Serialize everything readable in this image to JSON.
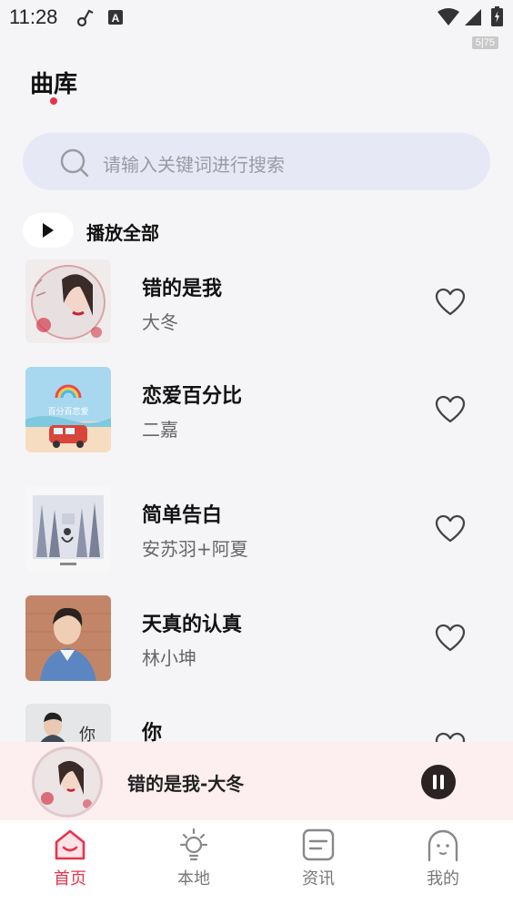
{
  "status_bar": {
    "time": "11:28",
    "fps": "5|75",
    "icons": [
      "link-icon",
      "a-icon",
      "wifi-icon",
      "signal-icon",
      "battery-icon"
    ]
  },
  "header": {
    "title": "曲库"
  },
  "search": {
    "placeholder": "请输入关键词进行搜索"
  },
  "play_all": {
    "label": "播放全部"
  },
  "songs": [
    {
      "title": "错的是我",
      "artist": "大冬",
      "liked": false
    },
    {
      "title": "恋爱百分比",
      "artist": "二嘉",
      "liked": false
    },
    {
      "title": "简单告白",
      "artist": "安苏羽+阿夏",
      "liked": false
    },
    {
      "title": "天真的认真",
      "artist": "林小坤",
      "liked": false
    },
    {
      "title": "你",
      "artist": "",
      "liked": false
    }
  ],
  "covers": {
    "song2_text": "百分百恋爱",
    "song5_text": "你"
  },
  "player": {
    "now_playing": "错的是我-大冬",
    "state": "playing"
  },
  "nav": {
    "items": [
      {
        "label": "首页",
        "icon": "home-icon",
        "active": true
      },
      {
        "label": "本地",
        "icon": "bulb-icon",
        "active": false
      },
      {
        "label": "资讯",
        "icon": "news-icon",
        "active": false
      },
      {
        "label": "我的",
        "icon": "profile-icon",
        "active": false
      }
    ]
  },
  "colors": {
    "accent": "#e8334a",
    "background": "#f5f5f8",
    "search_bg": "#e6e9f5",
    "player_bg": "#fdeeef"
  }
}
